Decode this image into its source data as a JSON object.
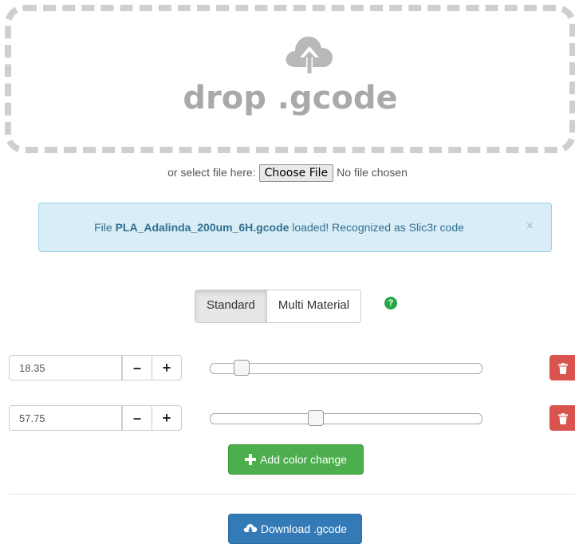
{
  "dropzone": {
    "label": "drop .gcode",
    "icon": "cloud-upload-icon"
  },
  "file_select": {
    "prefix": "or select file here:",
    "button_label": "Choose File",
    "status": "No file chosen"
  },
  "alert": {
    "prefix": "File ",
    "filename": "PLA_Adalinda_200um_6H.gcode",
    "suffix": " loaded! Recognized as Slic3r code",
    "close": "×"
  },
  "mode_toggle": {
    "options": [
      "Standard",
      "Multi Material"
    ],
    "selected": "Standard",
    "help_icon": "?"
  },
  "color_changes": [
    {
      "value": "18.35",
      "minus": "–",
      "plus": "+",
      "slider_fraction": 0.12,
      "delete_icon": "trash-icon"
    },
    {
      "value": "57.75",
      "minus": "–",
      "plus": "+",
      "slider_fraction": 0.39,
      "delete_icon": "trash-icon"
    }
  ],
  "add_button": {
    "icon": "plus-icon",
    "label": "Add color change"
  },
  "download_button": {
    "icon": "cloud-download-icon",
    "label": "Download .gcode"
  },
  "colors": {
    "alert_bg": "#d9edf7",
    "success": "#4cae4c",
    "primary": "#337ab7",
    "danger": "#d9534f"
  }
}
